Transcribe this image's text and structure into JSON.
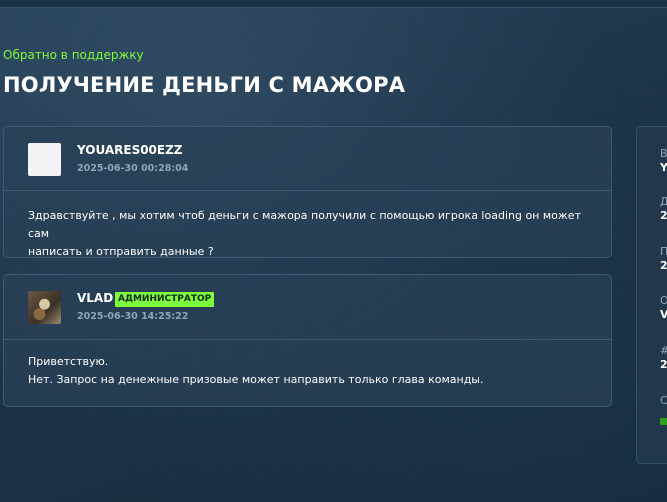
{
  "nav": {
    "back_link": "Обратно в поддержку"
  },
  "page": {
    "title": "ПОЛУЧЕНИЕ ДЕНЬГИ С МАЖОРА"
  },
  "messages": [
    {
      "author": "YOUARES00EZZ",
      "timestamp": "2025-06-30 00:28:04",
      "lines": [
        "Здравствуйте , мы хотим чтоб деньги с мажора получили с помощью игрока loading он может сам",
        "написать и отправить данные ?"
      ]
    },
    {
      "author": "VLAD",
      "badge": "АДМИНИСТРАТОР",
      "timestamp": "2025-06-30 14:25:22",
      "lines": [
        "Приветствую.",
        "Нет. Запрос на денежные призовые может направить только глава команды."
      ]
    }
  ],
  "sidebar": {
    "fields": [
      {
        "label": "В",
        "value": "Y"
      },
      {
        "label": "Д",
        "value": "2"
      },
      {
        "label": "П",
        "value": "2"
      },
      {
        "label": "О",
        "value": "V"
      },
      {
        "label": "#",
        "value": "2"
      },
      {
        "label": "С"
      }
    ],
    "status_color": "#2fa01c"
  },
  "colors": {
    "accent": "#7cfc3c",
    "muted": "#8ea6ba"
  }
}
